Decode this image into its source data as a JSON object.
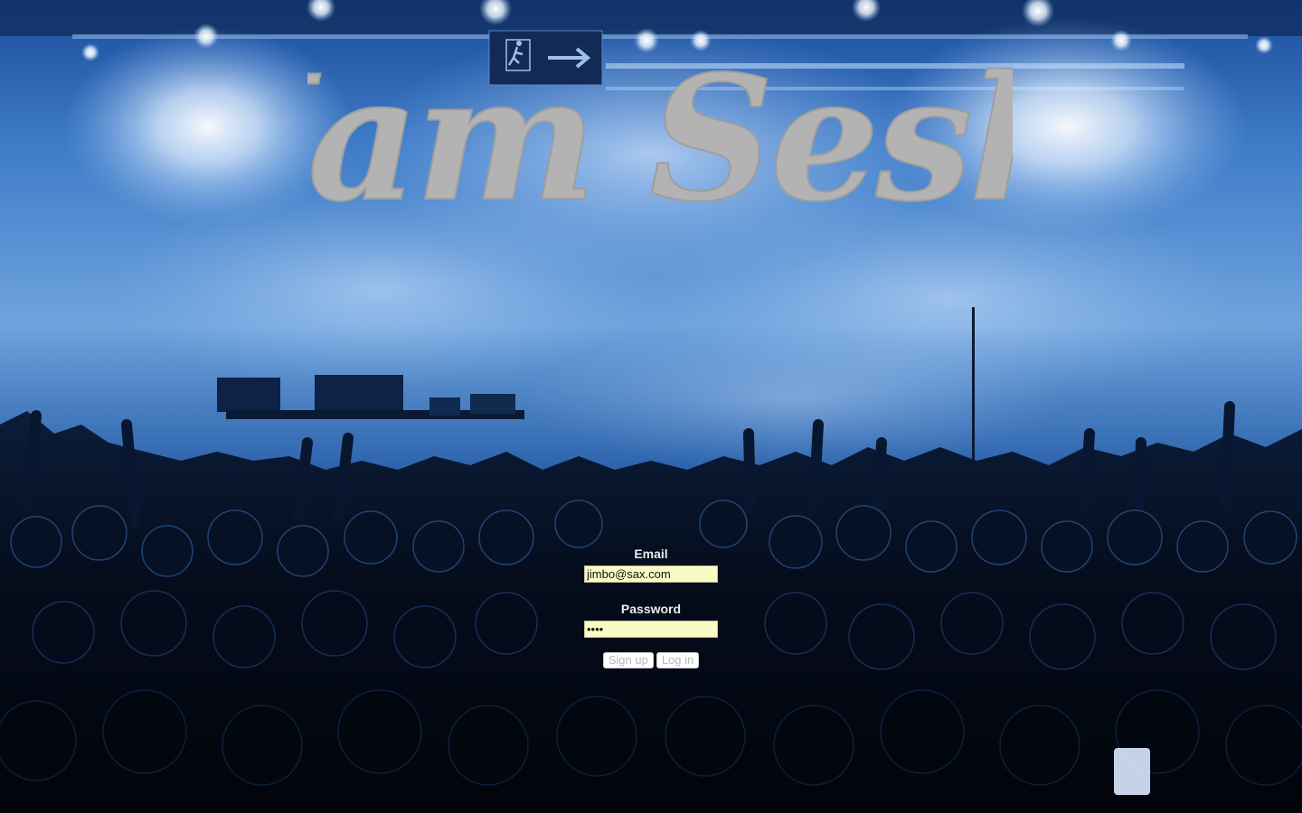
{
  "logo": {
    "text": "Jam Sesh"
  },
  "login": {
    "email_label": "Email",
    "email_value": "jimbo@sax.com",
    "password_label": "Password",
    "password_value": "••••",
    "signup_label": "Sign up",
    "login_label": "Log in"
  },
  "colors": {
    "logo": "#b3b3b3",
    "input_bg": "#fafbc4",
    "button_text": "#b8b8b8",
    "stage_light": "#cfe4ff",
    "crowd": "#050b18"
  },
  "icons": {
    "exit_sign": "running-person-exit-icon"
  }
}
